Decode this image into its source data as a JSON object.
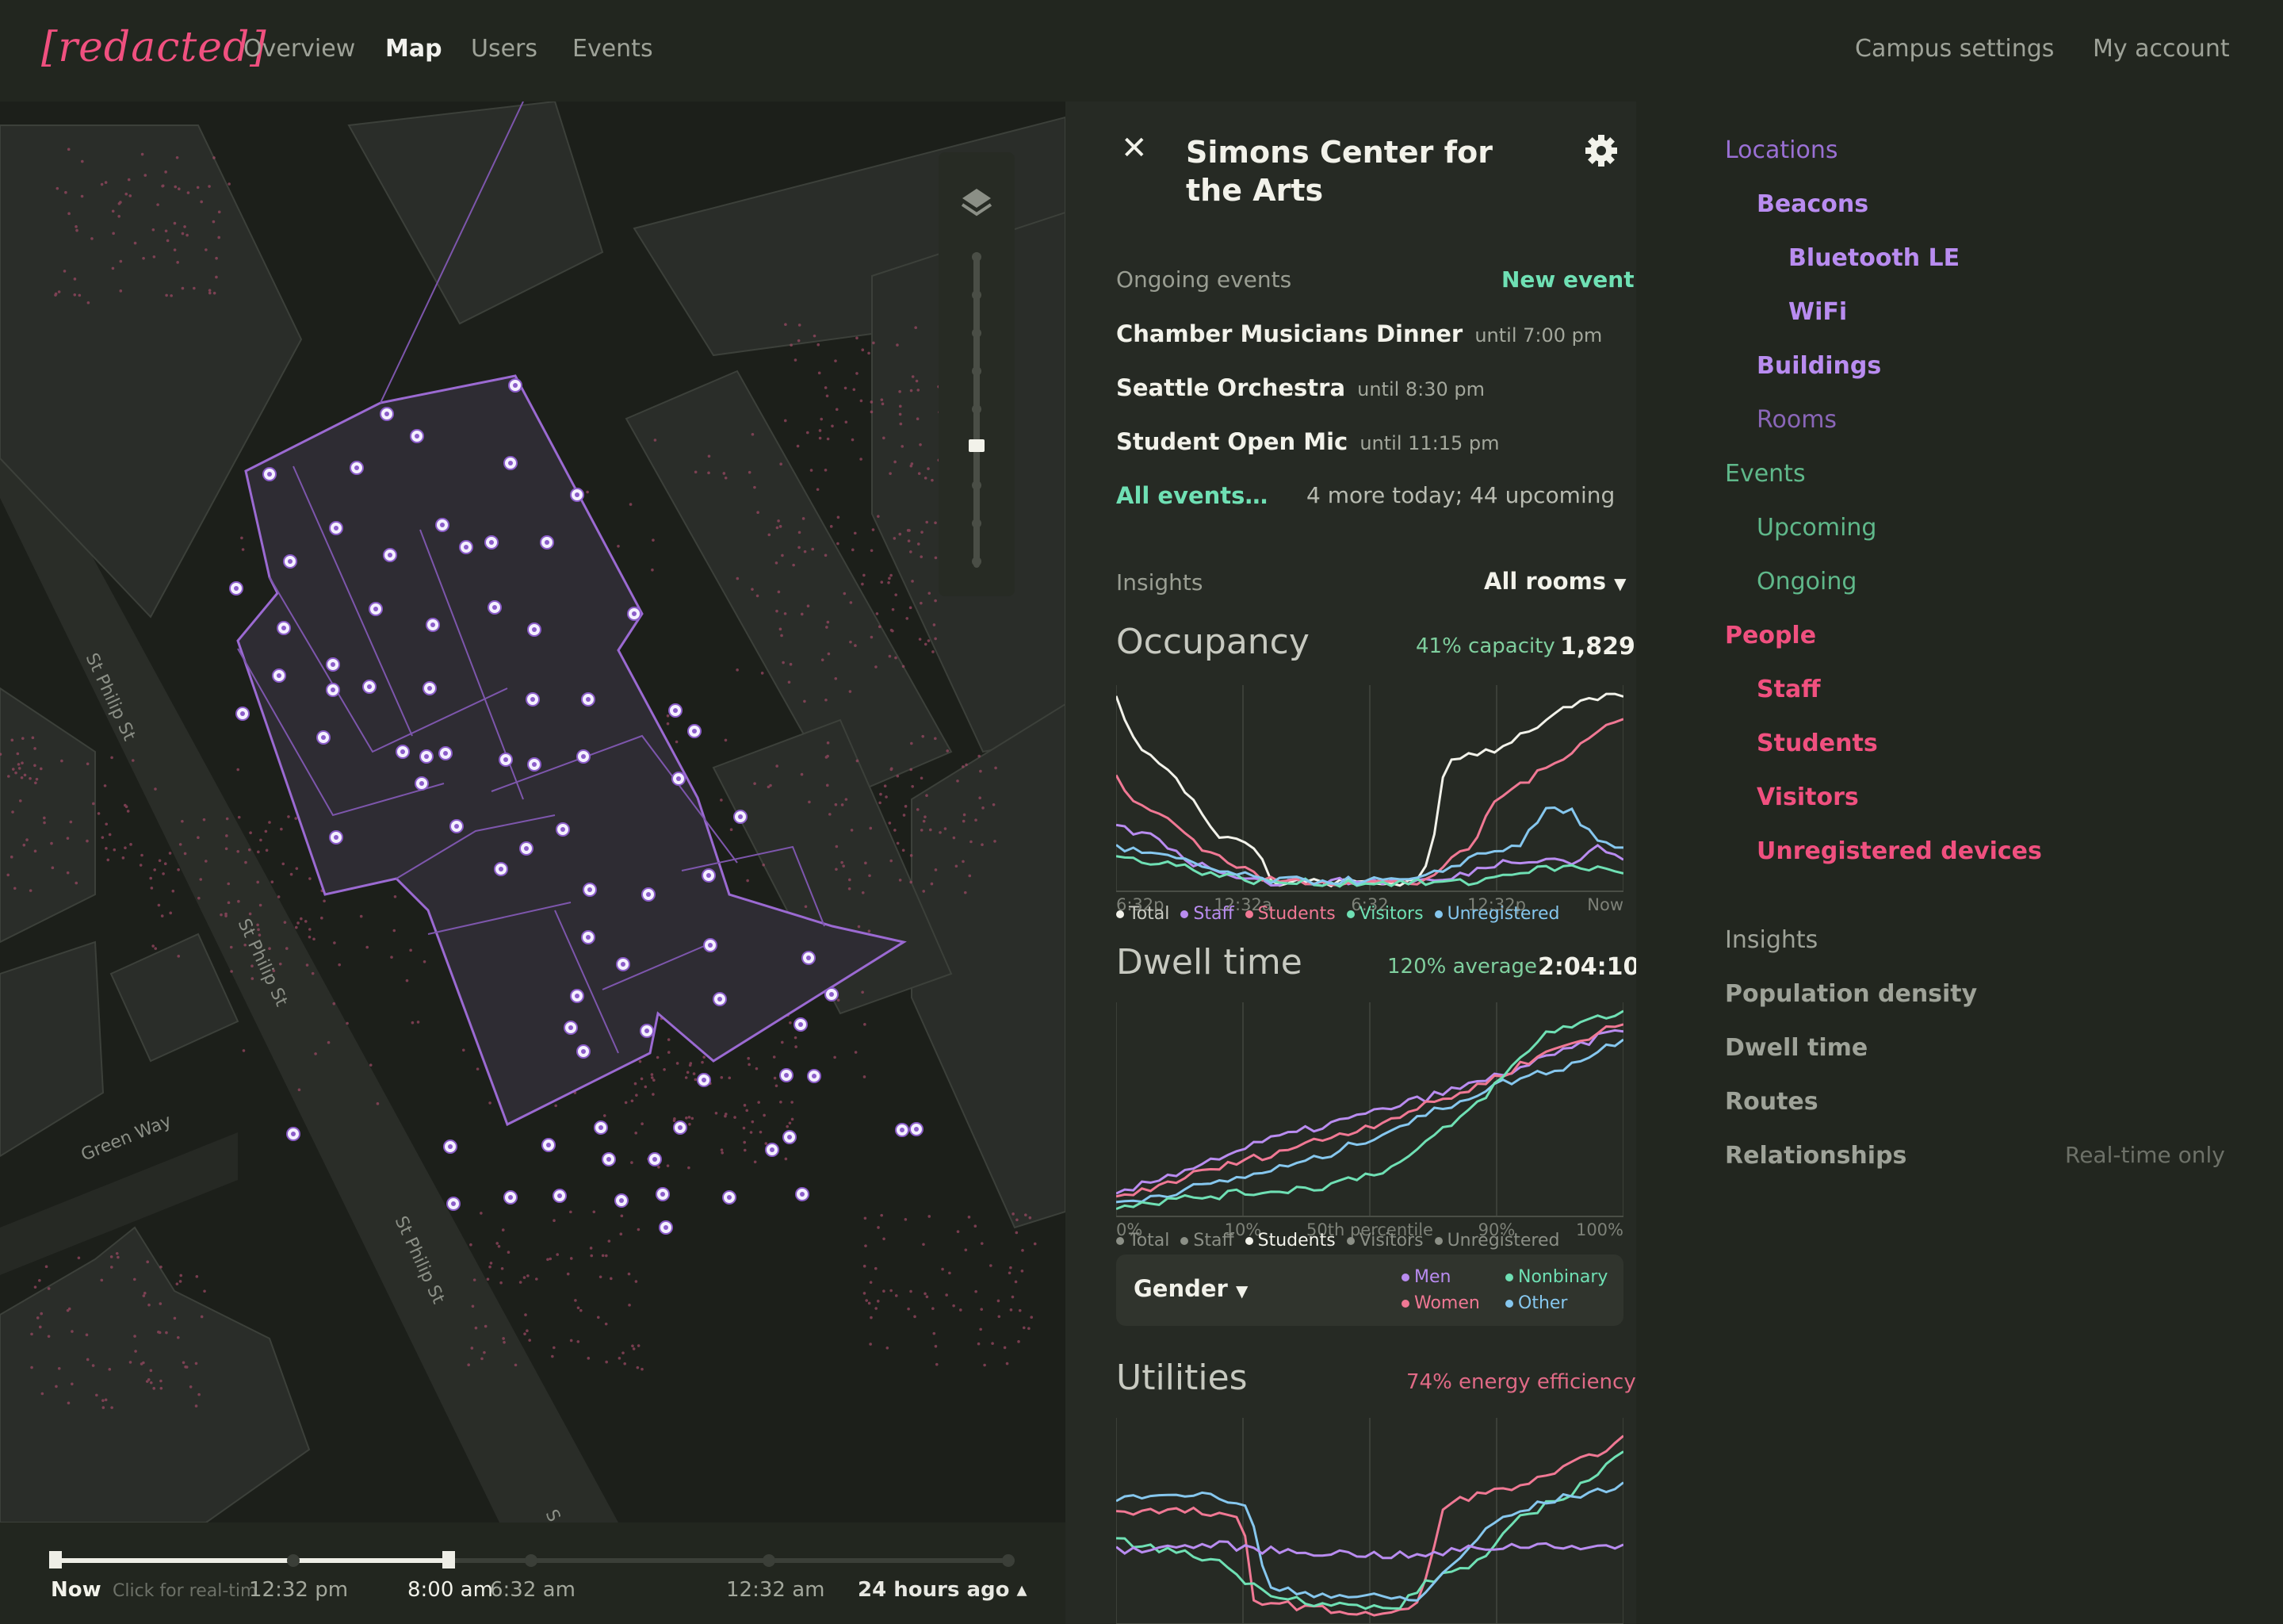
{
  "nav": {
    "logo": "[redacted]",
    "links": [
      "Overview",
      "Map",
      "Users",
      "Events"
    ],
    "active": "Map",
    "right_links": [
      "Campus settings",
      "My account"
    ]
  },
  "map": {
    "street_labels": [
      "St Philip St",
      "St Philip St",
      "St Philip St",
      "Green Way",
      "S"
    ],
    "icons": {
      "layers": "layers-icon"
    }
  },
  "timeline": {
    "now_label": "Now",
    "now_hint": "Click for real-time",
    "ticks": [
      "12:32 pm",
      "8:00 am",
      "6:32 am",
      "12:32 am"
    ],
    "range_label": "24 hours ago",
    "range_icon": "caret-up-icon"
  },
  "panel": {
    "title_line1": "Simons Center for",
    "title_line2": "the Arts",
    "close_icon": "close-icon",
    "settings_icon": "gear-icon",
    "ongoing_label": "Ongoing events",
    "new_event": "New event",
    "events": [
      {
        "name": "Chamber Musicians Dinner",
        "until": "until 7:00 pm"
      },
      {
        "name": "Seattle Orchestra",
        "until": "until 8:30 pm"
      },
      {
        "name": "Student Open Mic",
        "until": "until 11:15 pm"
      }
    ],
    "all_events": "All events…",
    "more_events": "4 more today; 44 upcoming",
    "insights_label": "Insights",
    "rooms_select": "All rooms",
    "occupancy": {
      "title": "Occupancy",
      "capacity": "41% capacity",
      "count": "1,829",
      "x_labels": [
        "6:32p",
        "12:32a",
        "6:32",
        "12:32p",
        "Now"
      ],
      "legend": [
        "Total",
        "Staff",
        "Students",
        "Visitors",
        "Unregistered"
      ]
    },
    "dwell": {
      "title": "Dwell time",
      "average": "120% average",
      "value": "2:04:10",
      "x_labels": [
        "0%",
        "10%",
        "50th percentile",
        "90%",
        "100%"
      ],
      "legend": [
        "Total",
        "Staff",
        "Students",
        "Visitors",
        "Unregistered"
      ],
      "active_legend": "Students",
      "gender_select": "Gender",
      "gender_legend": [
        "Men",
        "Nonbinary",
        "Women",
        "Other"
      ]
    },
    "utilities": {
      "title": "Utilities",
      "efficiency": "74% energy efficiency"
    }
  },
  "sidebar": {
    "locations": "Locations",
    "beacons": "Beacons",
    "bluetooth": "Bluetooth LE",
    "wifi": "WiFi",
    "buildings": "Buildings",
    "rooms": "Rooms",
    "events": "Events",
    "upcoming": "Upcoming",
    "ongoing": "Ongoing",
    "people": "People",
    "staff": "Staff",
    "students": "Students",
    "visitors": "Visitors",
    "unregistered": "Unregistered devices",
    "insights": "Insights",
    "density": "Population density",
    "dwell": "Dwell time",
    "routes": "Routes",
    "relationships": "Relationships",
    "realtime": "Real-time only"
  },
  "colors": {
    "accent_pink": "#f0507f",
    "purple": "#b98cf0",
    "teal": "#6fe0b4",
    "pink": "#f07894",
    "blue": "#86c7ee",
    "white": "#f2f2ea"
  }
}
